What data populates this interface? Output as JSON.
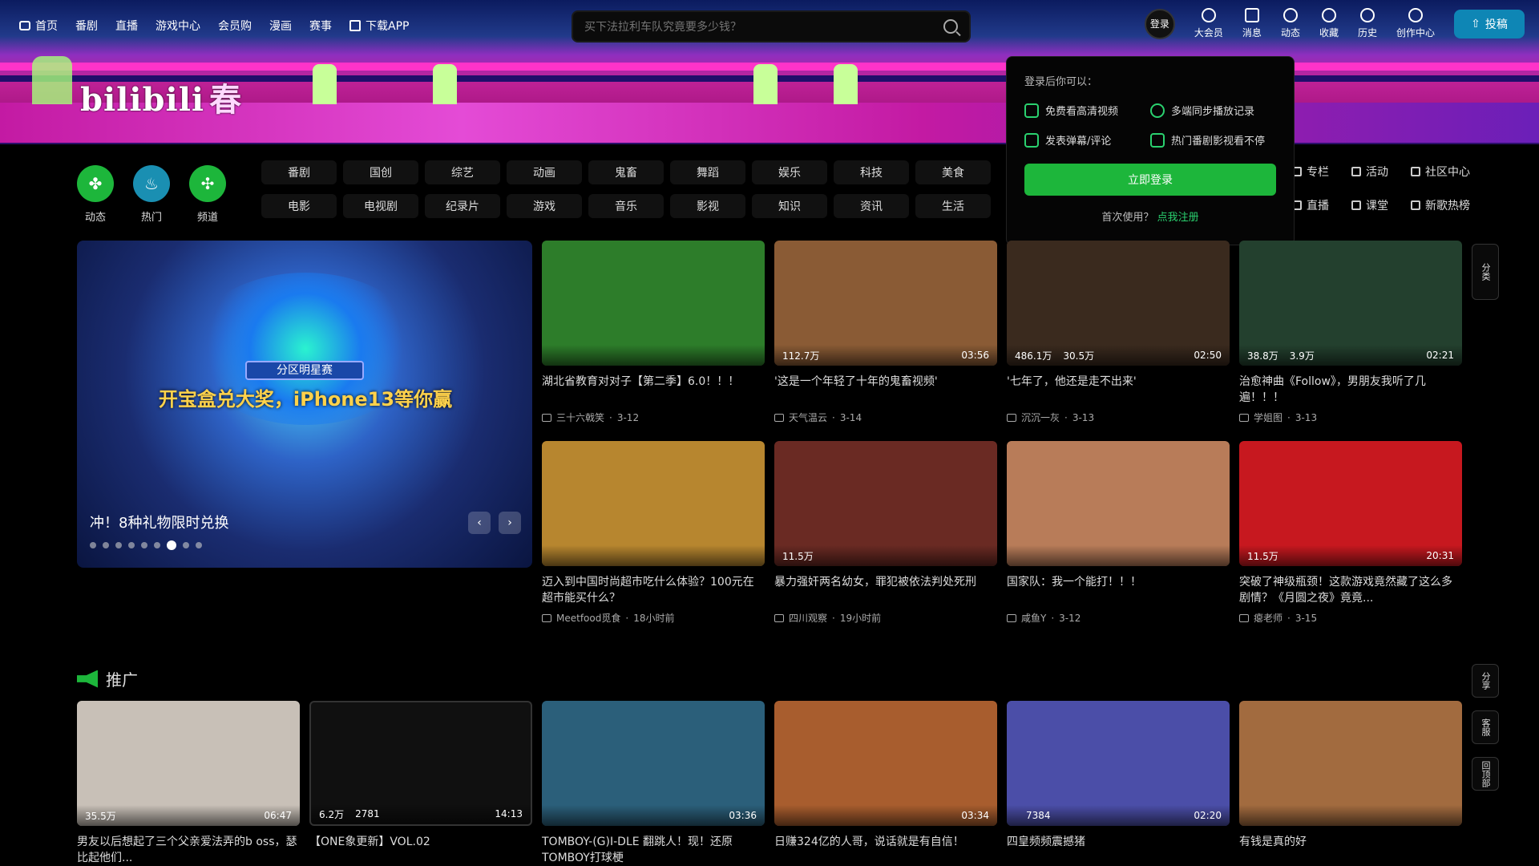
{
  "nav": {
    "left": [
      "首页",
      "番剧",
      "直播",
      "游戏中心",
      "会员购",
      "漫画",
      "赛事",
      "下载APP"
    ],
    "search_placeholder": "买下法拉利车队究竟要多少钱？",
    "right": [
      "大会员",
      "消息",
      "动态",
      "收藏",
      "历史",
      "创作中心"
    ],
    "login_label": "登录",
    "upload_label": "投稿"
  },
  "logo": {
    "text": "bilibili",
    "suffix": "春"
  },
  "popup": {
    "title": "登录后你可以：",
    "features": [
      "免费看高清视频",
      "多端同步播放记录",
      "发表弹幕/评论",
      "热门番剧影视看不停"
    ],
    "button": "立即登录",
    "register_text": "首次使用？",
    "register_link": "点我注册"
  },
  "channels": [
    {
      "label": "动态",
      "color": "#1db63b",
      "glyph": "✤"
    },
    {
      "label": "热门",
      "color": "#1a8fb2",
      "glyph": "♨"
    },
    {
      "label": "频道",
      "color": "#1db63b",
      "glyph": "✣"
    }
  ],
  "categories": [
    "番剧",
    "国创",
    "综艺",
    "动画",
    "鬼畜",
    "舞蹈",
    "娱乐",
    "科技",
    "美食",
    "电影",
    "电视剧",
    "纪录片",
    "游戏",
    "音乐",
    "影视",
    "知识",
    "资讯",
    "生活"
  ],
  "categories_right": [
    "专栏",
    "活动",
    "社区中心",
    "直播",
    "课堂",
    "新歌热榜"
  ],
  "carousel": {
    "headline": "开宝盒兑大奖，iPhone13等你赢",
    "subtitle": "分区明星赛",
    "caption": "冲！8种礼物限时兑换",
    "dots_total": 9,
    "active_dot": 6
  },
  "videos_top": [
    {
      "title": "湖北省教育对对子【第二季】6.0！！！",
      "author": "三十六戟笑",
      "date": "3-12",
      "views": "",
      "likes": "",
      "duration": "",
      "color": "#2d7d2a"
    },
    {
      "title": "'这是一个年轻了十年的鬼畜视频'",
      "author": "天气温云",
      "date": "3-14",
      "views": "112.7万",
      "likes": "",
      "duration": "03:56",
      "color": "#8a5b35"
    },
    {
      "title": "'七年了，他还是走不出来'",
      "author": "沉沉一灰",
      "date": "3-13",
      "views": "486.1万",
      "likes": "30.5万",
      "duration": "02:50",
      "color": "#3a2a1e"
    },
    {
      "title": "治愈神曲《Follow》，男朋友我听了几遍！！！",
      "author": "学姐图",
      "date": "3-13",
      "views": "38.8万",
      "likes": "3.9万",
      "duration": "02:21",
      "color": "#23402e"
    },
    {
      "title": "迈入到中国时尚超市吃什么体验？100元在超市能买什么？",
      "author": "Meetfood觅食",
      "date": "18小时前",
      "views": "",
      "likes": "",
      "duration": "",
      "color": "#b7862f"
    },
    {
      "title": "暴力强奸两名幼女，罪犯被依法判处死刑",
      "author": "四川观察",
      "date": "19小时前",
      "views": "11.5万",
      "likes": "",
      "duration": "",
      "color": "#6a2a23"
    },
    {
      "title": "国家队：我一个能打！！！",
      "author": "咸鱼Y",
      "date": "3-12",
      "views": "",
      "likes": "",
      "duration": "",
      "color": "#b87c59"
    },
    {
      "title": "突破了神级瓶颈！这款游戏竟然藏了这么多剧情？《月圆之夜》竟竟...",
      "author": "瘪老师",
      "date": "3-15",
      "views": "11.5万",
      "likes": "",
      "duration": "20:31",
      "color": "#c7181f"
    }
  ],
  "promo": {
    "title": "推广"
  },
  "videos_bottom": [
    {
      "title": "男友以后想起了三个父亲爱法弄的b oss，瑟比起他们...",
      "views": "35.5万",
      "likes": "",
      "duration": "06:47",
      "color": "#c8c0b7"
    },
    {
      "title": "【ONE象更新】VOL.02",
      "views": "6.2万",
      "likes": "2781",
      "duration": "14:13",
      "color": "#101010"
    },
    {
      "title": "TOMBOY-(G)I-DLE 翻跳人！现！还原TOMBOY打球梗",
      "views": "",
      "likes": "",
      "duration": "03:36",
      "color": "#2b5f7a"
    },
    {
      "title": "日赚324亿的人哥，说话就是有自信！",
      "views": "",
      "likes": "",
      "duration": "03:34",
      "color": "#a85d2e"
    },
    {
      "title": "四皇频频震撼猪",
      "views": "",
      "likes": "7384",
      "duration": "02:20",
      "color": "#4b4ea8"
    },
    {
      "title": "有钱是真的好",
      "views": "",
      "likes": "",
      "duration": "",
      "color": "#a26b3f"
    }
  ],
  "side_tools": [
    "分享",
    "客服",
    "回顶部"
  ],
  "side_tool_top": [
    "分",
    "类"
  ]
}
